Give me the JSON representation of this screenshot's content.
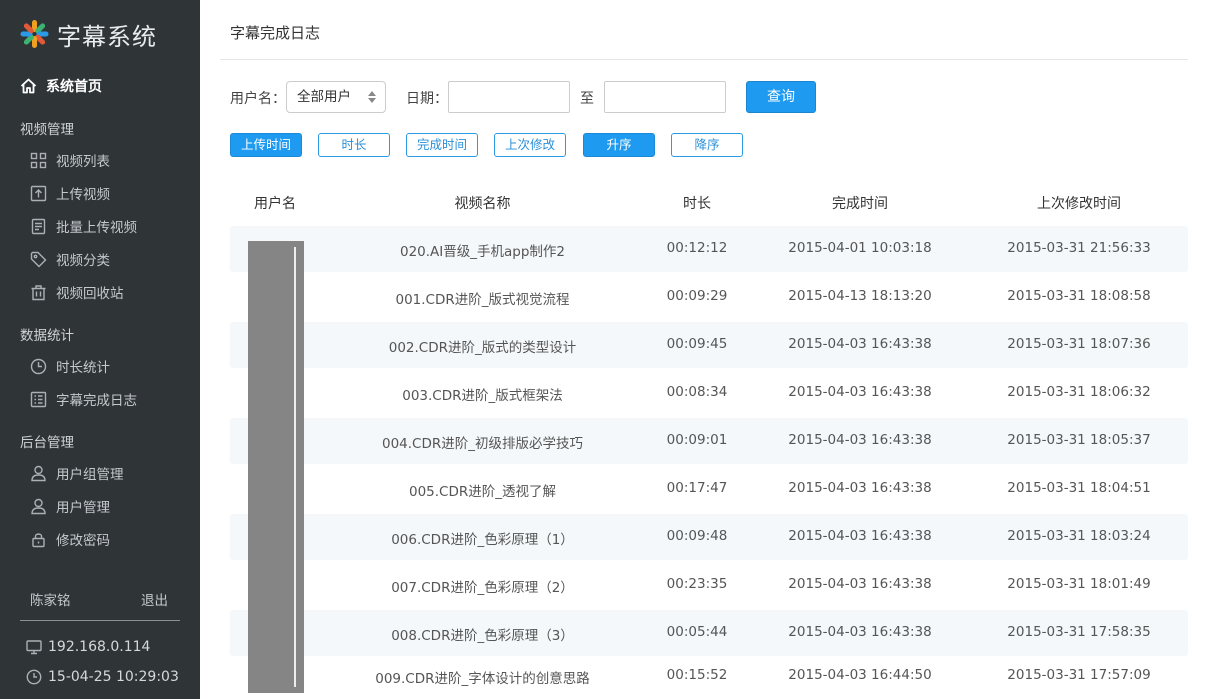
{
  "app": {
    "title": "字幕系统"
  },
  "sidebar": {
    "home_label": "系统首页",
    "sections": [
      {
        "title": "视频管理",
        "items": [
          "视频列表",
          "上传视频",
          "批量上传视频",
          "视频分类",
          "视频回收站"
        ]
      },
      {
        "title": "数据统计",
        "items": [
          "时长统计",
          "字幕完成日志"
        ]
      },
      {
        "title": "后台管理",
        "items": [
          "用户组管理",
          "用户管理",
          "修改密码"
        ]
      }
    ],
    "user_name": "陈家铭",
    "logout_label": "退出",
    "ip": "192.168.0.114",
    "datetime": "15-04-25 10:29:03"
  },
  "page": {
    "title": "字幕完成日志"
  },
  "filter": {
    "user_label": "用户名：",
    "user_select_value": "全部用户",
    "date_label": "日期：",
    "date_to_label": "至",
    "date_from_value": "",
    "date_to_value": "",
    "query_label": "查询"
  },
  "sort": {
    "buttons": [
      "上传时间",
      "时长",
      "完成时间",
      "上次修改"
    ],
    "active_field": "上传时间",
    "order": [
      "升序",
      "降序"
    ],
    "active_order": "升序"
  },
  "table": {
    "columns": [
      "用户名",
      "视频名称",
      "时长",
      "完成时间",
      "上次修改时间"
    ],
    "rows": [
      {
        "video": "020.AI晋级_手机app制作2",
        "duration": "00:12:12",
        "done": "2015-04-01 10:03:18",
        "modified": "2015-03-31 21:56:33"
      },
      {
        "video": "001.CDR进阶_版式视觉流程",
        "duration": "00:09:29",
        "done": "2015-04-13 18:13:20",
        "modified": "2015-03-31 18:08:58"
      },
      {
        "video": "002.CDR进阶_版式的类型设计",
        "duration": "00:09:45",
        "done": "2015-04-03 16:43:38",
        "modified": "2015-03-31 18:07:36"
      },
      {
        "video": "003.CDR进阶_版式框架法",
        "duration": "00:08:34",
        "done": "2015-04-03 16:43:38",
        "modified": "2015-03-31 18:06:32"
      },
      {
        "video": "004.CDR进阶_初级排版必学技巧",
        "duration": "00:09:01",
        "done": "2015-04-03 16:43:38",
        "modified": "2015-03-31 18:05:37"
      },
      {
        "video": "005.CDR进阶_透视了解",
        "duration": "00:17:47",
        "done": "2015-04-03 16:43:38",
        "modified": "2015-03-31 18:04:51"
      },
      {
        "video": "006.CDR进阶_色彩原理（1）",
        "duration": "00:09:48",
        "done": "2015-04-03 16:43:38",
        "modified": "2015-03-31 18:03:24"
      },
      {
        "video": "007.CDR进阶_色彩原理（2）",
        "duration": "00:23:35",
        "done": "2015-04-03 16:43:38",
        "modified": "2015-03-31 18:01:49"
      },
      {
        "video": "008.CDR进阶_色彩原理（3）",
        "duration": "00:05:44",
        "done": "2015-04-03 16:43:38",
        "modified": "2015-03-31 17:58:35"
      },
      {
        "video": "009.CDR进阶_字体设计的创意思路",
        "duration": "00:15:52",
        "done": "2015-04-03 16:44:50",
        "modified": "2015-03-31 17:57:09"
      }
    ]
  },
  "colors": {
    "sidebar_bg": "#2f3437",
    "accent": "#1e9bf0",
    "row_stripe": "#f4f8fb"
  }
}
